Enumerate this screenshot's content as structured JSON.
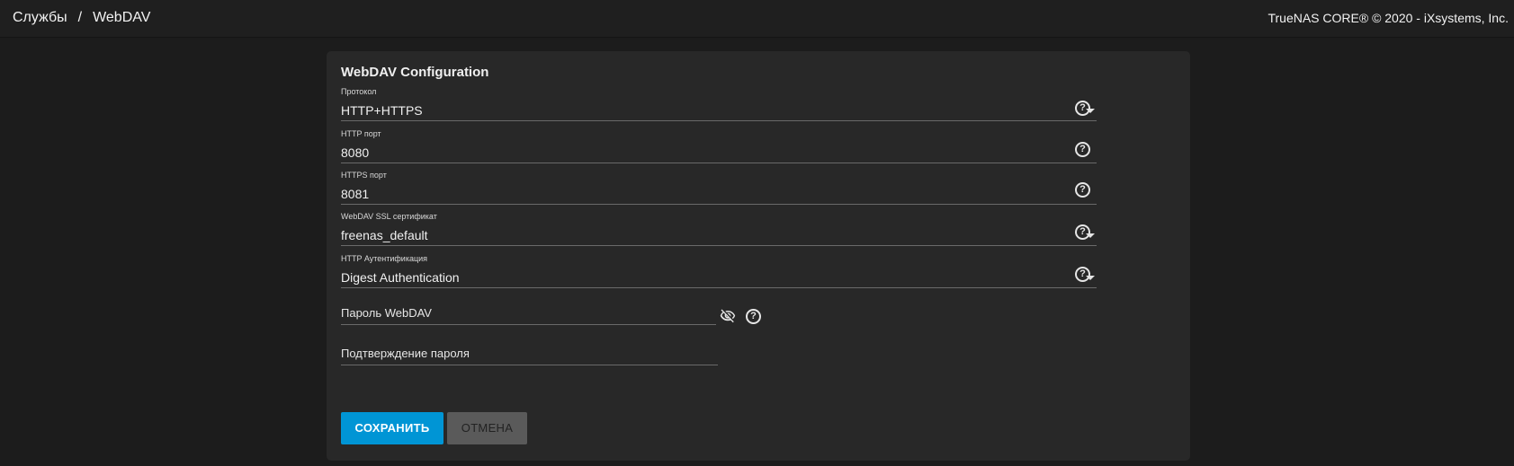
{
  "header": {
    "breadcrumb": [
      "Службы",
      "WebDAV"
    ],
    "separator": "/",
    "copyright": "TrueNAS CORE® © 2020 - iXsystems, Inc."
  },
  "form": {
    "title": "WebDAV Configuration",
    "fields": [
      {
        "label": "Протокол",
        "value": "HTTP+HTTPS",
        "type": "select",
        "icon": "help-icon"
      },
      {
        "label": "HTTP порт",
        "value": "8080",
        "type": "input",
        "icon": "help-icon"
      },
      {
        "label": "HTTPS порт",
        "value": "8081",
        "type": "input",
        "icon": "help-icon"
      },
      {
        "label": "WebDAV SSL сертификат",
        "value": "freenas_default",
        "type": "select",
        "icon": "help-icon"
      },
      {
        "label": "HTTP Аутентификация",
        "value": "Digest Authentication",
        "type": "select",
        "icon": "help-icon"
      }
    ],
    "password": {
      "placeholder": "Пароль WebDAV",
      "toggle_icon": "eye-off-icon",
      "help_icon": "help-icon"
    },
    "confirm_password": {
      "placeholder": "Подтверждение пароля"
    },
    "save_label": "СОХРАНИТЬ",
    "cancel_label": "ОТМЕНА"
  },
  "colors": {
    "background": "#1c1c1c",
    "card": "#282828",
    "primary_button": "#0095d5",
    "secondary_button": "#5a5a5a"
  }
}
